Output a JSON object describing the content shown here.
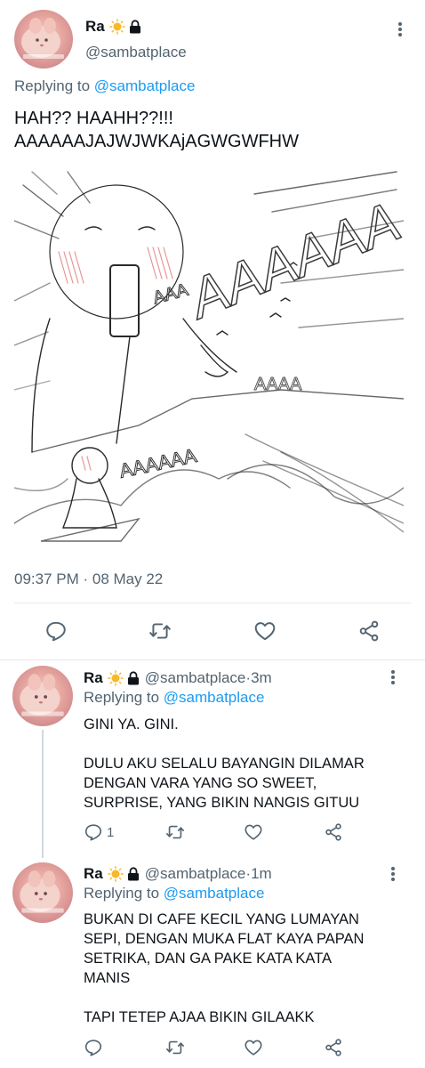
{
  "main_tweet": {
    "author_name": "Ra",
    "author_handle": "@sambatplace",
    "replying_prefix": "Replying to ",
    "replying_to": "@sambatplace",
    "text": "HAH?? HAAHH??!!!\nAAAAAAJAJWJWKAjAGWGWFHW",
    "timestamp": "09:37 PM · 08 May 22",
    "media_description_icon": "sketch-image",
    "media_text": {
      "top": "AAAAAA",
      "left": "AAA",
      "middle": "AAAA",
      "bottom": "AAAAAA"
    }
  },
  "replies": [
    {
      "author_name": "Ra",
      "author_handle": "@sambatplace",
      "separator": " · ",
      "time": "3m",
      "replying_prefix": "Replying to ",
      "replying_to": "@sambatplace",
      "text": "GINI YA. GINI.\n\nDULU AKU SELALU BAYANGIN DILAMAR\nDENGAN VARA YANG SO SWEET,\nSURPRISE, YANG BIKIN NANGIS GITUU",
      "reply_count": "1"
    },
    {
      "author_name": "Ra",
      "author_handle": "@sambatplace",
      "separator": " · ",
      "time": "1m",
      "replying_prefix": "Replying to ",
      "replying_to": "@sambatplace",
      "text": "BUKAN DI CAFE KECIL YANG LUMAYAN\nSEPI, DENGAN MUKA FLAT KAYA PAPAN\nSETRIKA, DAN GA PAKE KATA KATA\nMANIS\n\nTAPI TETEP AJAA BIKIN GILAAKK",
      "reply_count": ""
    }
  ],
  "colors": {
    "link": "#1d9bf0",
    "secondary_text": "#536471",
    "divider": "#e6e9ec",
    "thread_line": "#cfd9de"
  }
}
